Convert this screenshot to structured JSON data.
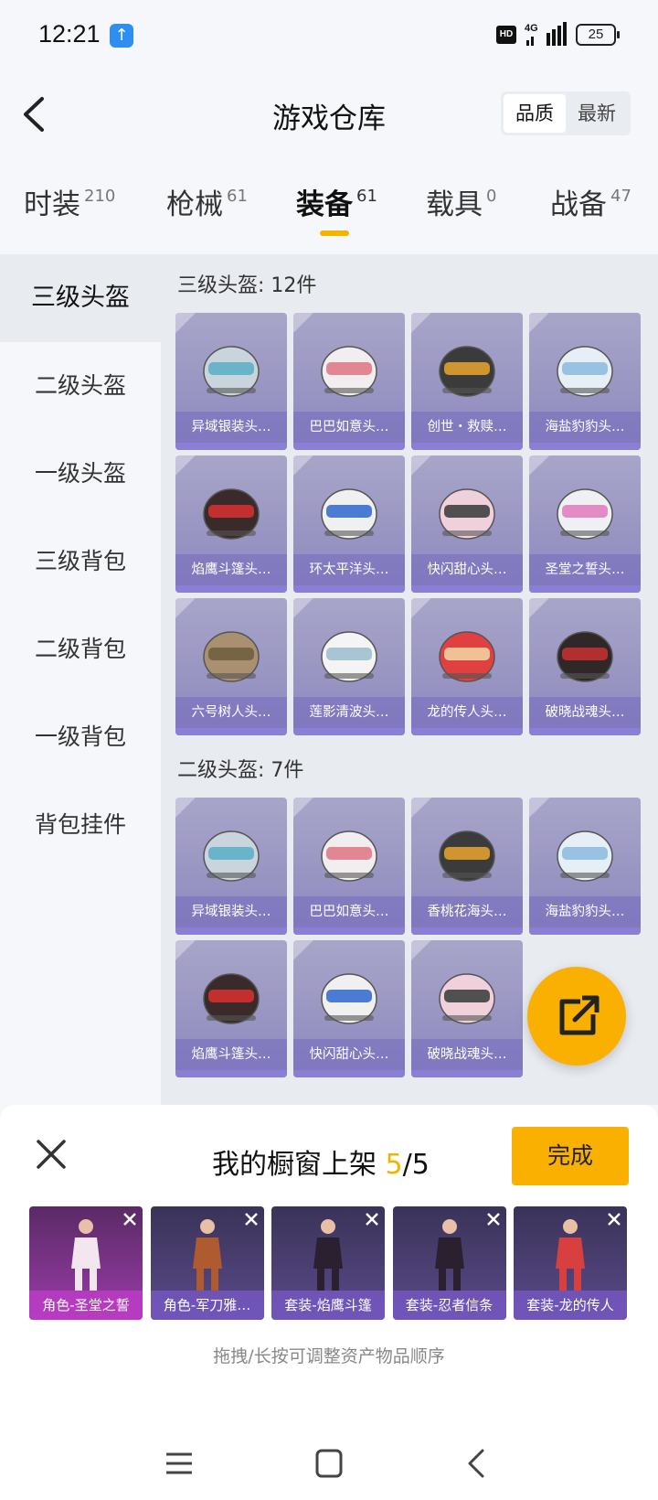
{
  "status": {
    "time": "12:21",
    "hd": "HD",
    "network": "4G",
    "battery": "25"
  },
  "header": {
    "title": "游戏仓库",
    "sort_options": [
      "品质",
      "最新"
    ],
    "active_sort": 0
  },
  "categories": [
    {
      "label": "时装",
      "count": "210"
    },
    {
      "label": "枪械",
      "count": "61"
    },
    {
      "label": "装备",
      "count": "61"
    },
    {
      "label": "载具",
      "count": "0"
    },
    {
      "label": "战备",
      "count": "47"
    }
  ],
  "sidebar": [
    "三级头盔",
    "二级头盔",
    "一级头盔",
    "三级背包",
    "二级背包",
    "一级背包",
    "背包挂件"
  ],
  "sections": [
    {
      "title": "三级头盔: 12件",
      "items": [
        "异域银装头…",
        "巴巴如意头…",
        "创世・救赎…",
        "海盐豹豹头…",
        "焰鹰斗篷头…",
        "环太平洋头…",
        "快闪甜心头…",
        "圣堂之誓头…",
        "六号树人头…",
        "莲影清波头…",
        "龙的传人头…",
        "破晓战魂头…"
      ]
    },
    {
      "title": "二级头盔: 7件",
      "items": [
        "异域银装头…",
        "巴巴如意头…",
        "香桃花海头…",
        "海盐豹豹头…",
        "焰鹰斗篷头…",
        "快闪甜心头…",
        "破晓战魂头…"
      ]
    }
  ],
  "panel": {
    "title_prefix": "我的橱窗上架 ",
    "current": "5",
    "total": "/5",
    "done_label": "完成",
    "showcase": [
      "角色-圣堂之誓",
      "角色-军刀雅…",
      "套装-焰鹰斗篷",
      "套装-忍者信条",
      "套装-龙的传人"
    ],
    "hint": "拖拽/长按可调整资产物品顺序"
  }
}
